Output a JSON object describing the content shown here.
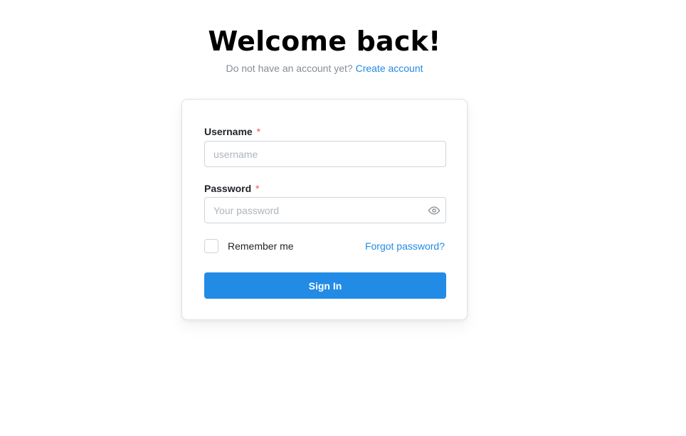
{
  "header": {
    "title": "Welcome back!",
    "subtitle_text": "Do not have an account yet?",
    "create_account_link": "Create account"
  },
  "form": {
    "username": {
      "label": "Username",
      "required_mark": "*",
      "placeholder": "username",
      "value": ""
    },
    "password": {
      "label": "Password",
      "required_mark": "*",
      "placeholder": "Your password",
      "value": "",
      "toggle_icon": "eye-icon"
    },
    "remember_me": {
      "label": "Remember me",
      "checked": false
    },
    "forgot_password_link": "Forgot password?",
    "submit_label": "Sign In"
  },
  "colors": {
    "accent": "#228be6",
    "required": "#fa5252",
    "muted_text": "#868e96",
    "border": "#ced4da"
  }
}
